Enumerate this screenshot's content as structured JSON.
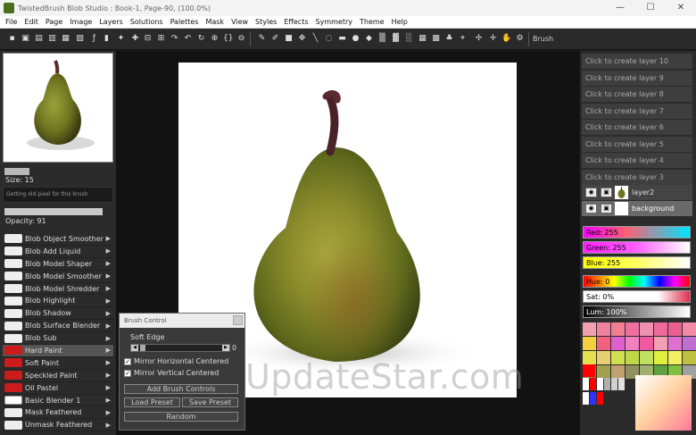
{
  "window": {
    "title": "TwistedBrush Blob Studio : Book-1, Page-90, (100.0%)"
  },
  "menu": [
    "File",
    "Edit",
    "Page",
    "Image",
    "Layers",
    "Solutions",
    "Palettes",
    "Mask",
    "View",
    "Styles",
    "Effects",
    "Symmetry",
    "Theme",
    "Help"
  ],
  "toolbar": {
    "brush_label": "Brush"
  },
  "left_panel": {
    "size_label": "Size: 15",
    "hint_text": "Getting old pixel for this brush",
    "opacity_label": "Opacity: 91",
    "brushes": [
      {
        "label": "Blob Object Smoother",
        "icon": "blob-oval-icon"
      },
      {
        "label": "Blob Add Liquid",
        "icon": "blob-oval-icon"
      },
      {
        "label": "Blob Model Shaper",
        "icon": "blob-oval-icon"
      },
      {
        "label": "Blob Model Smoother",
        "icon": "blob-oval-icon"
      },
      {
        "label": "Blob Model Shredder",
        "icon": "blob-oval-icon"
      },
      {
        "label": "Blob Highlight",
        "icon": "blob-oval-icon"
      },
      {
        "label": "Blob Shadow",
        "icon": "blob-oval-icon"
      },
      {
        "label": "Blob Surface Blender",
        "icon": "blob-oval-icon"
      },
      {
        "label": "Blob Sub",
        "icon": "blob-oval-icon"
      },
      {
        "label": "Hard Paint",
        "icon": "red-stroke-icon"
      },
      {
        "label": "Soft Paint",
        "icon": "red-stroke-icon"
      },
      {
        "label": "Speckled Paint",
        "icon": "red-stroke-icon"
      },
      {
        "label": "Oil Pastel",
        "icon": "red-stroke-icon"
      },
      {
        "label": "Basic Blender 1",
        "icon": "white-stroke-icon"
      },
      {
        "label": "Mask Feathered",
        "icon": "black-stroke-icon"
      },
      {
        "label": "Unmask Feathered",
        "icon": "black-stroke-icon"
      }
    ]
  },
  "brush_control": {
    "title": "Brush Control",
    "soft_edge_label": "Soft Edge",
    "soft_edge_value": "0",
    "mirror_h_label": "Mirror Horizontal Centered",
    "mirror_v_label": "Mirror Vertical Centered",
    "add_brush_controls": "Add Brush Controls",
    "load_preset": "Load Preset",
    "save_preset": "Save Preset",
    "random": "Random"
  },
  "layers": {
    "placeholders": [
      "Click to create layer 10",
      "Click to create layer 9",
      "Click to create layer 8",
      "Click to create layer 7",
      "Click to create layer 6",
      "Click to create layer 5",
      "Click to create layer 4",
      "Click to create layer 3"
    ],
    "real": [
      {
        "name": "layer2"
      },
      {
        "name": "background"
      }
    ]
  },
  "color": {
    "red_label": "Red: 255",
    "green_label": "Green: 255",
    "blue_label": "Blue: 255",
    "hue_label": "Hue: 0",
    "sat_label": "Sat: 0%",
    "lum_label": "Lum: 100%",
    "swatches": [
      "#f2a0b0",
      "#f080a0",
      "#f08090",
      "#ee70a0",
      "#f090b0",
      "#ef6a9a",
      "#e86090",
      "#f28aa8",
      "#f4d040",
      "#f26080",
      "#e060d0",
      "#f080c0",
      "#f058a0",
      "#f0a0b0",
      "#e070d0",
      "#c070d0",
      "#e6e050",
      "#e6d070",
      "#d0e050",
      "#c0d848",
      "#c0e060",
      "#e0f040",
      "#f0f060",
      "#c0c040",
      "#808040",
      "#a0a050",
      "#c0a070",
      "#909060",
      "#a0b070",
      "#60a040",
      "#80c040",
      "#a0a0a0"
    ]
  },
  "watermark": "UpdateStar.com"
}
